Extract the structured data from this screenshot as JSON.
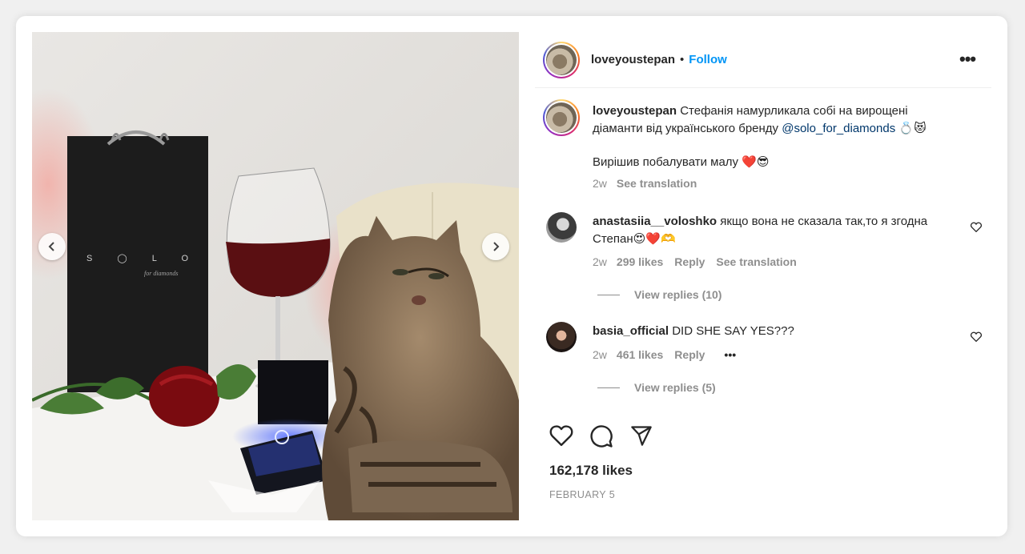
{
  "post": {
    "author": "loveyoustepan",
    "separator": "•",
    "follow_label": "Follow",
    "more_icon": "more-options-icon",
    "photo_logo": "S ◯ L O",
    "photo_logo_sub": "for diamonds"
  },
  "caption": {
    "author": "loveyoustepan",
    "line1": "Стефанія намурликала собі на вирощені",
    "line2_prefix": "діаманти від українського бренду",
    "mention": "@solo_for_diamonds",
    "line2_emoji": "💍😻",
    "line3": "Вирішив побалувати малу ❤️😎",
    "time": "2w",
    "see_translation": "See translation"
  },
  "comments": [
    {
      "author": "anastasiia__voloshko",
      "text_line1": "якщо вона не сказала так,то я згодна",
      "text_line2": "Степан😍❤️🫶",
      "time": "2w",
      "likes": "299 likes",
      "reply": "Reply",
      "see_translation": "See translation",
      "view_replies": "View replies (10)"
    },
    {
      "author": "basia_official",
      "text_line1": "DID SHE SAY YES???",
      "time": "2w",
      "likes": "461 likes",
      "reply": "Reply",
      "more": "•••",
      "view_replies": "View replies (5)"
    }
  ],
  "stats": {
    "likes": "162,178 likes",
    "date": "FEBRUARY 5"
  },
  "colors": {
    "link_blue": "#0095f6",
    "mention_blue": "#00376b",
    "muted": "#8e8e8e",
    "text": "#262626"
  }
}
